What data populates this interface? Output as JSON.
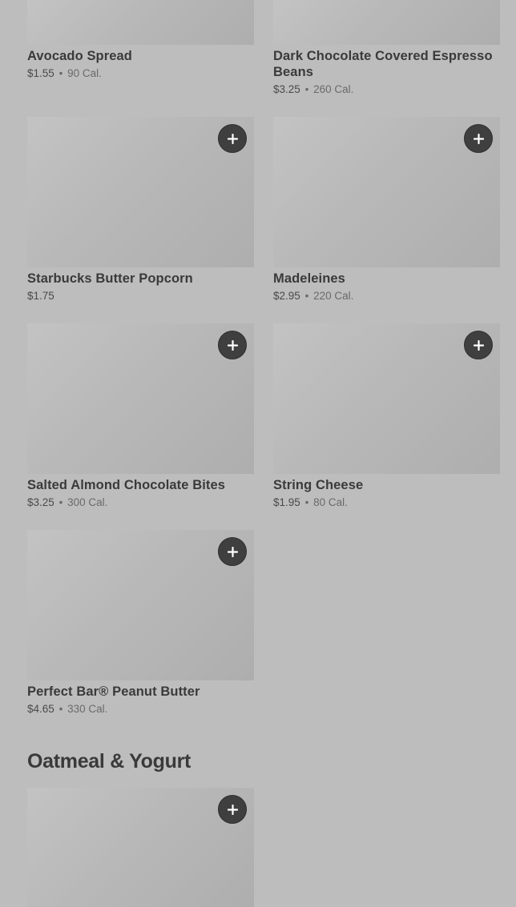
{
  "items": [
    {
      "title": "Avocado Spread",
      "price": "$1.55",
      "separator": "•",
      "calories": "90 Cal."
    },
    {
      "title": "Dark Chocolate Covered Espresso Beans",
      "price": "$3.25",
      "separator": "•",
      "calories": "260 Cal."
    },
    {
      "title": "Starbucks Butter Popcorn",
      "price": "$1.75",
      "separator": "",
      "calories": ""
    },
    {
      "title": "Madeleines",
      "price": "$2.95",
      "separator": "•",
      "calories": "220 Cal."
    },
    {
      "title": "Salted Almond Chocolate Bites",
      "price": "$3.25",
      "separator": "•",
      "calories": "300 Cal."
    },
    {
      "title": "String Cheese",
      "price": "$1.95",
      "separator": "•",
      "calories": "80 Cal."
    },
    {
      "title": "Perfect Bar® Peanut Butter",
      "price": "$4.65",
      "separator": "•",
      "calories": "330 Cal."
    }
  ],
  "section": {
    "heading": "Oatmeal & Yogurt"
  },
  "icons": {
    "add": "plus-icon"
  },
  "colors": {
    "background": "#bdbdbd",
    "add_button": "#3f3f3f",
    "text": "#3a3a3a"
  }
}
